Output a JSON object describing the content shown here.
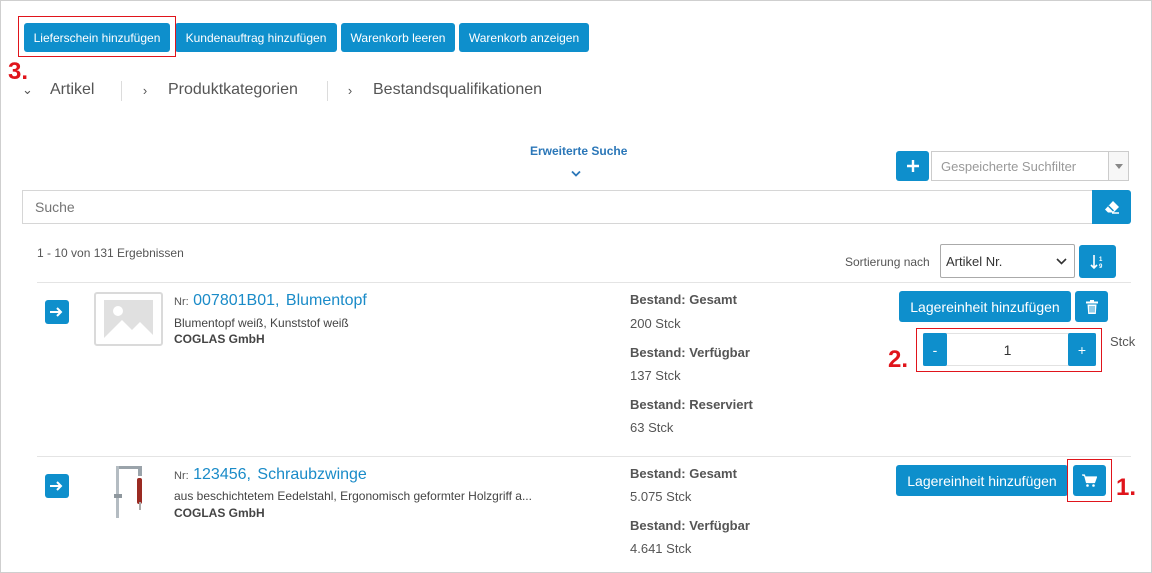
{
  "toolbar": {
    "delivery_note": "Lieferschein hinzufügen",
    "sales_order": "Kundenauftrag hinzufügen",
    "cart_clear": "Warenkorb leeren",
    "cart_show": "Warenkorb anzeigen"
  },
  "markers": {
    "m1": "1.",
    "m2": "2.",
    "m3": "3."
  },
  "tabs": [
    {
      "label": "Artikel",
      "expanded": true
    },
    {
      "label": "Produktkategorien",
      "expanded": false
    },
    {
      "label": "Bestandsqualifikationen",
      "expanded": false
    }
  ],
  "search": {
    "advanced": "Erweiterte Suche",
    "placeholder": "Suche",
    "saved_filter_placeholder": "Gespeicherte Suchfilter"
  },
  "results": {
    "summary": "1 - 10 von 131 Ergebnissen",
    "sort_label": "Sortierung nach",
    "sort_value": "Artikel Nr."
  },
  "items": [
    {
      "nr_prefix": "Nr:",
      "nr": "007801B01,",
      "name": "Blumentopf",
      "description": "Blumentopf weiß, Kunststof weiß",
      "company": "COGLAS GmbH",
      "stock": [
        {
          "label": "Bestand: Gesamt",
          "value": "200 Stck"
        },
        {
          "label": "Bestand: Verfügbar",
          "value": "137 Stck"
        },
        {
          "label": "Bestand: Reserviert",
          "value": "63 Stck"
        }
      ],
      "add_unit": "Lagereinheit hinzufügen",
      "qty": {
        "minus": "-",
        "value": "1",
        "plus": "+",
        "unit": "Stck"
      }
    },
    {
      "nr_prefix": "Nr:",
      "nr": "123456,",
      "name": "Schraubzwinge",
      "description": "aus beschichtetem Eedelstahl, Ergonomisch geformter Holzgriff a...",
      "company": "COGLAS GmbH",
      "stock": [
        {
          "label": "Bestand: Gesamt",
          "value": "5.075 Stck"
        },
        {
          "label": "Bestand: Verfügbar",
          "value": "4.641 Stck"
        }
      ],
      "add_unit": "Lagereinheit hinzufügen"
    }
  ],
  "colors": {
    "accent": "#0e8fcc",
    "highlight": "#e0141b",
    "link": "#1a8bc8"
  }
}
